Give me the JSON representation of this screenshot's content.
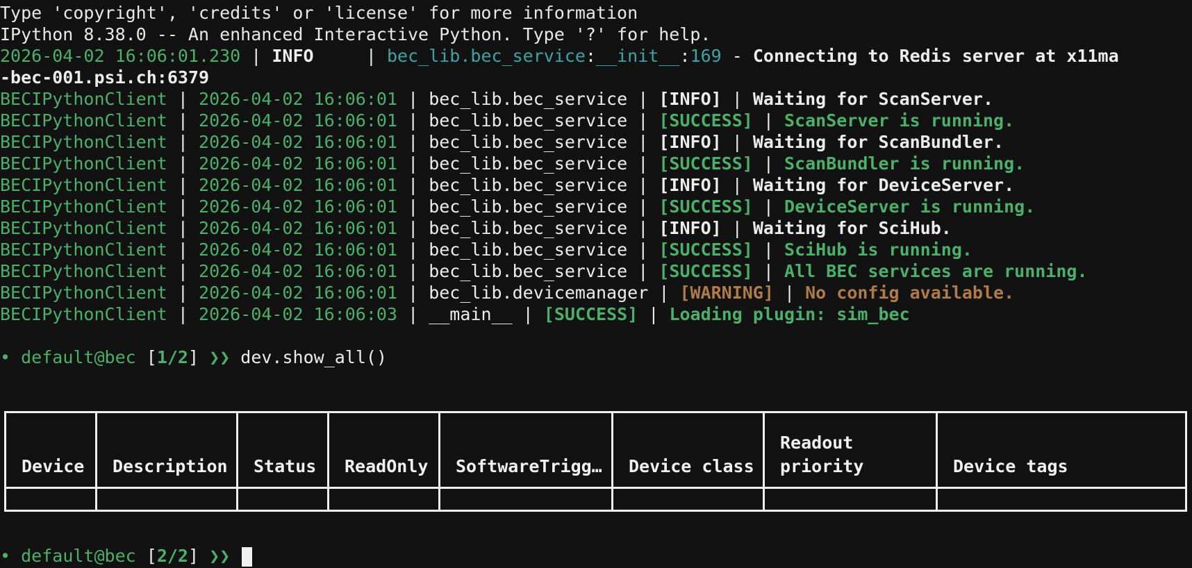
{
  "terminal": {
    "lines": [
      {
        "text": "Type 'copyright', 'credits' or 'license' for more information"
      },
      {
        "text": "IPython 8.38.0 -- An enhanced Interactive Python. Type '?' for help."
      }
    ],
    "init_log": {
      "timestamp": "2026-04-02 16:06:01.230",
      "level": "INFO",
      "source": "bec_lib.bec_service",
      "func": "__init__",
      "lineno": "169",
      "message_1": "Connecting to Redis server at x11ma",
      "message_2": "-bec-001.psi.ch:6379"
    },
    "logs": [
      {
        "client": "BECIPythonClient",
        "time": "2026-04-02 16:06:01",
        "module": "bec_lib.bec_service",
        "level": "[INFO]",
        "msg": "Waiting for ScanServer.",
        "kind": "info"
      },
      {
        "client": "BECIPythonClient",
        "time": "2026-04-02 16:06:01",
        "module": "bec_lib.bec_service",
        "level": "[SUCCESS]",
        "msg": "ScanServer is running.",
        "kind": "success"
      },
      {
        "client": "BECIPythonClient",
        "time": "2026-04-02 16:06:01",
        "module": "bec_lib.bec_service",
        "level": "[INFO]",
        "msg": "Waiting for ScanBundler.",
        "kind": "info"
      },
      {
        "client": "BECIPythonClient",
        "time": "2026-04-02 16:06:01",
        "module": "bec_lib.bec_service",
        "level": "[SUCCESS]",
        "msg": "ScanBundler is running.",
        "kind": "success"
      },
      {
        "client": "BECIPythonClient",
        "time": "2026-04-02 16:06:01",
        "module": "bec_lib.bec_service",
        "level": "[INFO]",
        "msg": "Waiting for DeviceServer.",
        "kind": "info"
      },
      {
        "client": "BECIPythonClient",
        "time": "2026-04-02 16:06:01",
        "module": "bec_lib.bec_service",
        "level": "[SUCCESS]",
        "msg": "DeviceServer is running.",
        "kind": "success"
      },
      {
        "client": "BECIPythonClient",
        "time": "2026-04-02 16:06:01",
        "module": "bec_lib.bec_service",
        "level": "[INFO]",
        "msg": "Waiting for SciHub.",
        "kind": "info"
      },
      {
        "client": "BECIPythonClient",
        "time": "2026-04-02 16:06:01",
        "module": "bec_lib.bec_service",
        "level": "[SUCCESS]",
        "msg": "SciHub is running.",
        "kind": "success"
      },
      {
        "client": "BECIPythonClient",
        "time": "2026-04-02 16:06:01",
        "module": "bec_lib.bec_service",
        "level": "[SUCCESS]",
        "msg": "All BEC services are running.",
        "kind": "success"
      },
      {
        "client": "BECIPythonClient",
        "time": "2026-04-02 16:06:01",
        "module": "bec_lib.devicemanager",
        "level": "[WARNING]",
        "msg": "No config available.",
        "kind": "warning"
      },
      {
        "client": "BECIPythonClient",
        "time": "2026-04-02 16:06:03",
        "module": "__main__",
        "level": "[SUCCESS]",
        "msg": "Loading plugin: sim_bec",
        "kind": "success"
      }
    ],
    "separator": "|",
    "prompt_1": {
      "dot": "•",
      "user": "default@bec",
      "open": "[",
      "num": "1/2",
      "close": "]",
      "arrow": "❯❯",
      "command": "dev.show_all()"
    },
    "prompt_2": {
      "dot": "•",
      "user": "default@bec",
      "open": "[",
      "num": "2/2",
      "close": "]",
      "arrow": "❯❯",
      "command": ""
    },
    "table": {
      "headers": [
        "Device",
        "Description",
        "Status",
        "ReadOnly",
        "SoftwareTrigg…",
        "Device class",
        "Readout priority",
        "Device tags"
      ]
    }
  },
  "colors": {
    "background": "#121212",
    "green": "#4caf6a",
    "cyan": "#3fa3a6",
    "warning": "#b07a4a",
    "white": "#ececec"
  }
}
